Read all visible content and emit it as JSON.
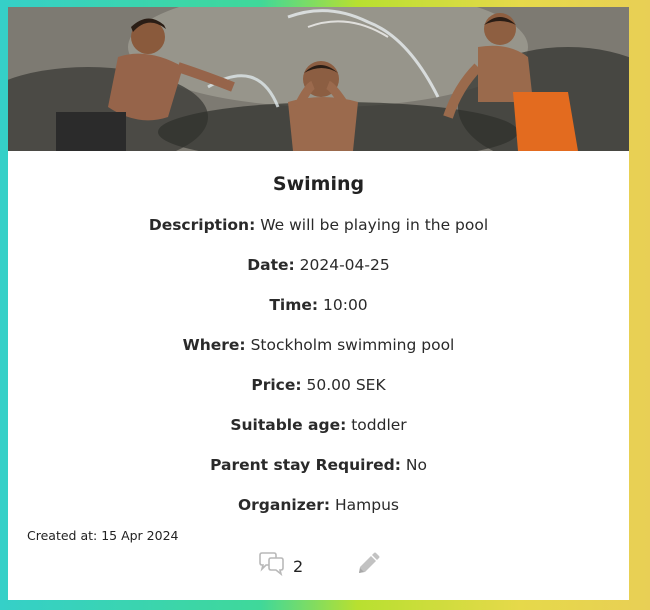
{
  "event": {
    "title": "Swiming",
    "description_label": "Description:",
    "description": "We will be playing in the pool",
    "date_label": "Date:",
    "date": "2024-04-25",
    "time_label": "Time:",
    "time": "10:00",
    "where_label": "Where:",
    "where": "Stockholm swimming pool",
    "price_label": "Price:",
    "price": "50.00 SEK",
    "age_label": "Suitable age:",
    "age": "toddler",
    "parent_label": "Parent stay Required:",
    "parent": "No",
    "organizer_label": "Organizer:",
    "organizer": "Hampus",
    "created": "Created at: 15 Apr 2024"
  },
  "footer": {
    "comment_count": "2",
    "comment_icon": "comments-icon",
    "edit_icon": "pencil-icon"
  }
}
